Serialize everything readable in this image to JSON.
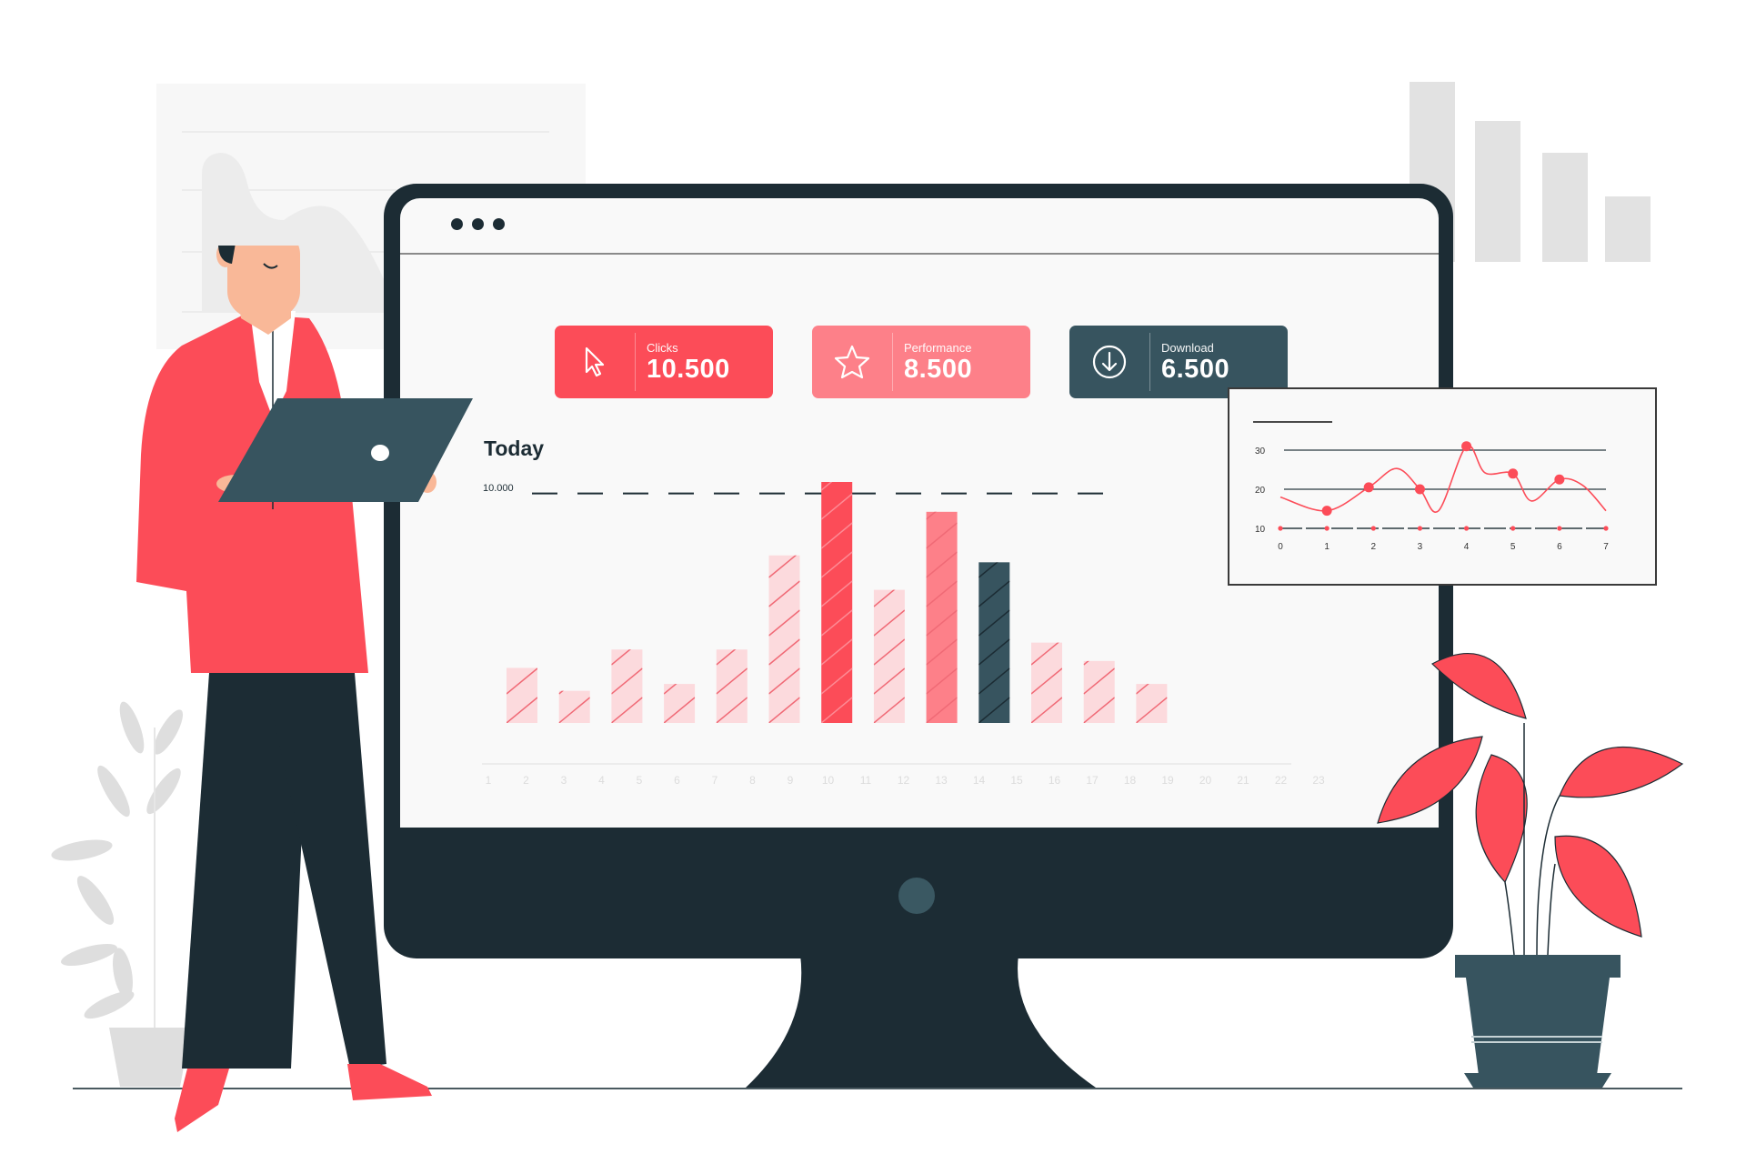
{
  "window": {
    "dots": 3
  },
  "stats": [
    {
      "label": "Clicks",
      "value": "10.500",
      "icon": "cursor-icon",
      "color": "#fc4c58"
    },
    {
      "label": "Performance",
      "value": "8.500",
      "icon": "star-icon",
      "color": "#fd8089"
    },
    {
      "label": "Download",
      "value": "6.500",
      "icon": "download-icon",
      "color": "#37545f"
    }
  ],
  "colors": {
    "accent": "#fc4c58",
    "accent_light": "#fcdadd",
    "accent_mid": "#fd8089",
    "dark": "#1c2c34",
    "teal": "#37545f"
  },
  "chart_data": [
    {
      "type": "bar",
      "title": "Today",
      "reference_line": {
        "value": 10000,
        "label": "10.000"
      },
      "categories": [
        "1",
        "2",
        "3",
        "4",
        "5",
        "6",
        "7",
        "8",
        "9",
        "10",
        "11",
        "12",
        "13",
        "14",
        "15",
        "16",
        "17",
        "18",
        "19",
        "20",
        "21",
        "22",
        "23"
      ],
      "values": [
        2400,
        1400,
        3200,
        1700,
        3200,
        7300,
        10500,
        5800,
        9200,
        7000,
        3500,
        2700,
        1700
      ],
      "bar_styles": [
        "light",
        "light",
        "light",
        "light",
        "light",
        "light",
        "accent",
        "light",
        "mid",
        "dark",
        "light",
        "light",
        "light"
      ],
      "ylim": [
        0,
        10500
      ],
      "xlabel": "",
      "ylabel": ""
    },
    {
      "type": "line",
      "x": [
        0,
        1,
        2,
        3,
        4,
        5,
        6,
        7
      ],
      "marker_x": [
        1,
        1.9,
        3,
        4,
        5,
        6
      ],
      "marker_y": [
        14.5,
        20.5,
        20,
        31,
        24,
        22.5
      ],
      "curve_points": [
        [
          0,
          18
        ],
        [
          1,
          14.5
        ],
        [
          1.9,
          20.5
        ],
        [
          2.5,
          25.3
        ],
        [
          3,
          20
        ],
        [
          3.4,
          14.5
        ],
        [
          4,
          31
        ],
        [
          4.4,
          24.2
        ],
        [
          5,
          24
        ],
        [
          5.4,
          17
        ],
        [
          6,
          22.5
        ],
        [
          6.5,
          21
        ],
        [
          7,
          14.5
        ]
      ],
      "yticks": [
        10,
        20,
        30
      ],
      "xticks": [
        "0",
        "1",
        "2",
        "3",
        "4",
        "5",
        "6",
        "7"
      ],
      "ylim": [
        5,
        35
      ],
      "xlim": [
        0,
        7
      ]
    }
  ]
}
